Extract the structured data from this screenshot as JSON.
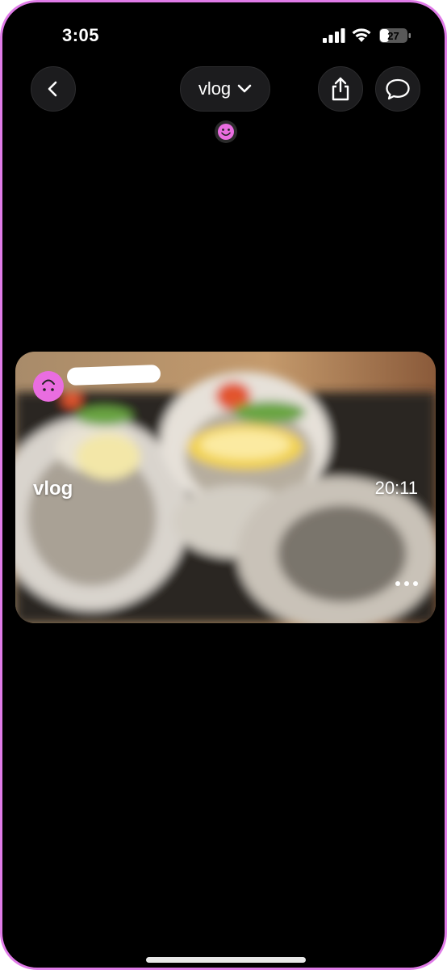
{
  "status_bar": {
    "time": "3:05",
    "battery_level": "27",
    "icons": [
      "cellular-signal-icon",
      "wifi-icon",
      "battery-icon"
    ]
  },
  "header": {
    "back_icon": "chevron-left-icon",
    "album_title": "vlog",
    "dropdown_icon": "chevron-down-icon",
    "share_icon": "share-icon",
    "comment_icon": "speech-bubble-icon",
    "reaction_icon": "smiley-icon"
  },
  "card": {
    "title": "vlog",
    "time": "20:11",
    "more_icon": "ellipsis-icon",
    "avatar_icon": "upside-down-smiley-icon"
  },
  "colors": {
    "accent": "#e96de0",
    "background": "#000000",
    "button_bg": "#1c1c1e"
  }
}
